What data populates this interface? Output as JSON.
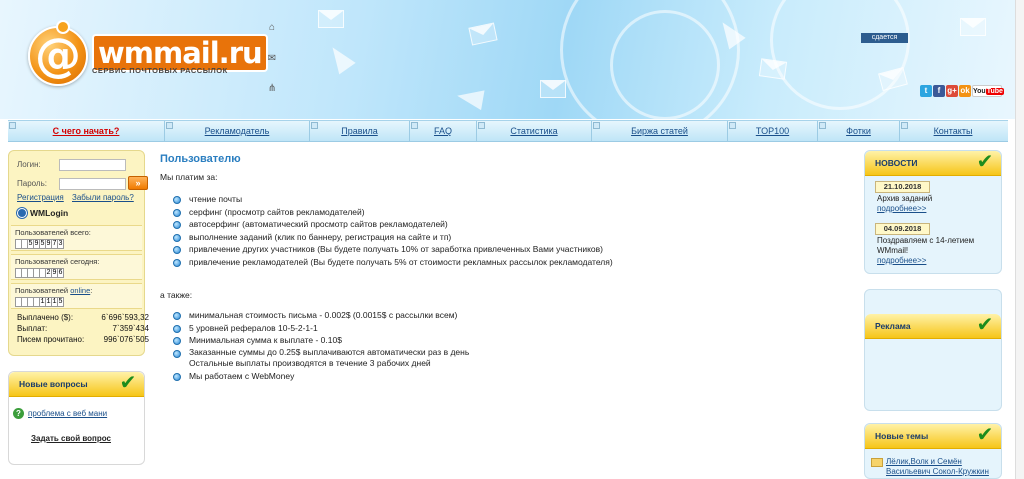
{
  "header": {
    "logo_text": "wmmail.ru",
    "logo_sub": "СЕРВИС ПОЧТОВЫХ РАССЫЛОК",
    "logo_symbol": "@",
    "rent_label": "сдается",
    "icons": [
      "home-icon",
      "mail-icon",
      "sitemap-icon"
    ]
  },
  "nav": {
    "items": [
      {
        "label": "С чего начать?"
      },
      {
        "label": "Рекламодатель"
      },
      {
        "label": "Правила"
      },
      {
        "label": "FAQ"
      },
      {
        "label": "Статистика"
      },
      {
        "label": "Биржа статей"
      },
      {
        "label": "TOP100"
      },
      {
        "label": "Фотки"
      },
      {
        "label": "Контакты"
      }
    ]
  },
  "login": {
    "login_label": "Логин:",
    "password_label": "Пароль:",
    "register_link": "Регистрация",
    "forgot_link": "Забыли пароль?",
    "wmlogin": "WMLogin",
    "go_label": "»",
    "users_total_label": "Пользователей всего:",
    "users_total_digits": [
      "",
      "",
      "5",
      "9",
      "5",
      "9",
      "7",
      "3"
    ],
    "users_today_label": "Пользователей сегодня:",
    "users_today_digits": [
      "",
      "",
      "",
      "",
      "",
      "2",
      "9",
      "6"
    ],
    "users_online_prefix": "Пользователей",
    "users_online_link": "online",
    "users_online_suffix": ":",
    "users_online_digits": [
      "",
      "",
      "",
      "",
      "1",
      "1",
      "1",
      "5"
    ],
    "paid_label": "Выплачено ($):",
    "paid_value": "6`696`593,32",
    "payout_label": "Выплат:",
    "payout_value": "7`359`434",
    "letters_label": "Писем прочитано:",
    "letters_value": "996`076`505"
  },
  "questions": {
    "title": "Новые вопросы",
    "item": "проблема с веб мани",
    "ask": "Задать свой вопрос"
  },
  "main": {
    "title": "Пользователю",
    "intro": "Мы платим за:",
    "pay_items": [
      "чтение почты",
      "серфинг (просмотр сайтов рекламодателей)",
      "автосерфинг (автоматический просмотр сайтов рекламодателей)",
      "выполнение заданий (клик по баннеру, регистрация на сайте и тп)",
      "привлечение других участников (Вы будете получать 10% от заработка привлеченных Вами участников)",
      "привлечение рекламодателей (Вы будете получать 5% от стоимости рекламных рассылок рекламодателя)"
    ],
    "also": "а также:",
    "also_items": [
      "минимальная стоимость письма - 0.002$ (0.0015$ с рассылки всем)",
      "5 уровней рефералов 10-5-2-1-1",
      "Минимальная сумма к выплате - 0.10$"
    ],
    "also_two_line_a": "Заказанные суммы до 0.25$ выплачиваются автоматически раз в день",
    "also_two_line_b": "Остальные выплаты производятся в течение 3 рабочих дней",
    "also_last": "Мы работаем с WebMoney"
  },
  "news": {
    "title": "НОВОСТИ",
    "items": [
      {
        "date": "21.10.2018",
        "text": "Архив заданий",
        "more": "подробнее>>"
      },
      {
        "date": "04.09.2018",
        "text": "Поздравляем с 14-летием WMmail!",
        "more": "подробнее>>"
      }
    ]
  },
  "ads": {
    "title": "Реклама"
  },
  "topics": {
    "title": "Новые темы",
    "item": "Лёлик,Волк и Семён Васильевич Сокол-Кружкин"
  },
  "socials": [
    "telegram",
    "facebook",
    "google-plus",
    "odnoklassniki",
    "youtube"
  ],
  "social_labels": [
    "t",
    "f",
    "g+",
    "ok",
    "You",
    "Tube"
  ],
  "colors": {
    "accent": "#f39214",
    "nav_first": "#d40000",
    "link": "#1a4f8a",
    "title": "#2a7ec0",
    "box_yellow": "#f6c518"
  }
}
